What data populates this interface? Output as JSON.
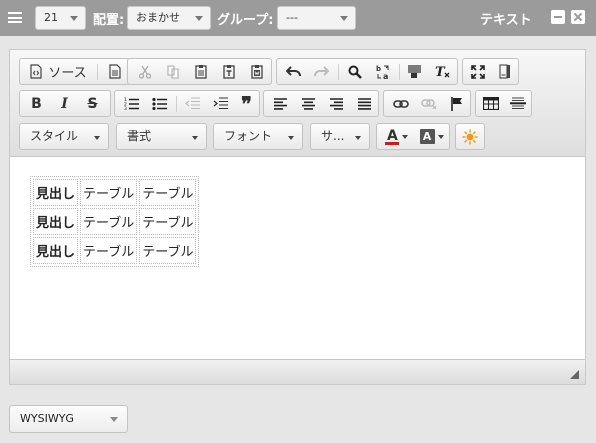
{
  "topbar": {
    "size_value": "21",
    "align_label": "配置:",
    "align_value": "おまかせ",
    "group_label": "グループ:",
    "group_value": "---",
    "title": "テキスト"
  },
  "toolbar": {
    "source_label": "ソース",
    "style_combo": "スタイル",
    "format_combo": "書式",
    "font_combo": "フォント",
    "size_combo": "サ...",
    "bold_glyph": "B",
    "italic_glyph": "I",
    "strike_glyph": "S",
    "quote_glyph": "❞",
    "text_color_glyph": "A",
    "bg_color_glyph": "A"
  },
  "content": {
    "rows": [
      [
        "見出し",
        "テーブル",
        "テーブル"
      ],
      [
        "見出し",
        "テーブル",
        "テーブル"
      ],
      [
        "見出し",
        "テーブル",
        "テーブル"
      ]
    ]
  },
  "mode": {
    "value": "WYSIWYG"
  },
  "colors": {
    "topbar_bg": "#9b9b9b",
    "page_bg": "#e6e6e6",
    "text_color_underline": "#d11a1a",
    "bg_color_swatch": "#555555",
    "sun_icon": "#f29a1c"
  }
}
